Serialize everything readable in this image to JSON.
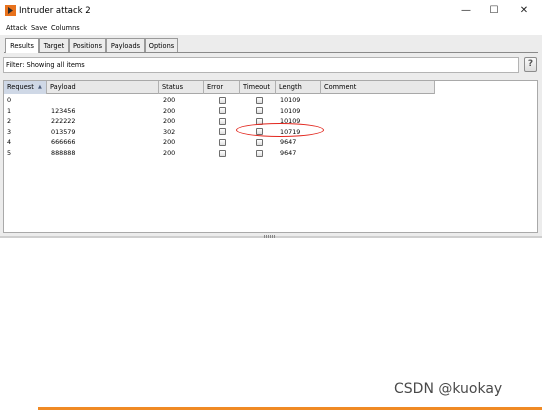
{
  "window": {
    "title": "Intruder attack 2",
    "controls": [
      "minimize",
      "maximize",
      "close"
    ]
  },
  "menu": [
    "Attack",
    "Save",
    "Columns"
  ],
  "tabs": [
    {
      "label": "Results",
      "active": true
    },
    {
      "label": "Target",
      "active": false
    },
    {
      "label": "Positions",
      "active": false
    },
    {
      "label": "Payloads",
      "active": false
    },
    {
      "label": "Options",
      "active": false
    }
  ],
  "filter": {
    "text": "Filter: Showing all items",
    "help_label": "?"
  },
  "table": {
    "columns": [
      "Request",
      "Payload",
      "Status",
      "Error",
      "Timeout",
      "Length",
      "Comment"
    ],
    "sort_indicator": "▲",
    "rows": [
      {
        "request": "0",
        "payload": "",
        "status": "200",
        "error": false,
        "timeout": false,
        "length": "10109",
        "comment": ""
      },
      {
        "request": "1",
        "payload": "123456",
        "status": "200",
        "error": false,
        "timeout": false,
        "length": "10109",
        "comment": ""
      },
      {
        "request": "2",
        "payload": "222222",
        "status": "200",
        "error": false,
        "timeout": false,
        "length": "10109",
        "comment": ""
      },
      {
        "request": "3",
        "payload": "013579",
        "status": "302",
        "error": false,
        "timeout": false,
        "length": "10719",
        "comment": ""
      },
      {
        "request": "4",
        "payload": "666666",
        "status": "200",
        "error": false,
        "timeout": false,
        "length": "9647",
        "comment": ""
      },
      {
        "request": "5",
        "payload": "888888",
        "status": "200",
        "error": false,
        "timeout": false,
        "length": "9647",
        "comment": ""
      }
    ]
  },
  "watermark": "CSDN @kuokay",
  "colors": {
    "highlight": "#e2261d",
    "accent_bar": "#f08a24",
    "app_icon": "#e8721c"
  }
}
